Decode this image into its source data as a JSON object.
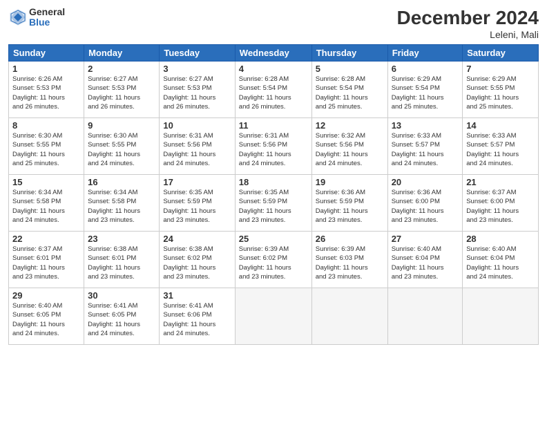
{
  "logo": {
    "general": "General",
    "blue": "Blue"
  },
  "header": {
    "title": "December 2024",
    "location": "Leleni, Mali"
  },
  "weekdays": [
    "Sunday",
    "Monday",
    "Tuesday",
    "Wednesday",
    "Thursday",
    "Friday",
    "Saturday"
  ],
  "weeks": [
    [
      {
        "day": "1",
        "info": "Sunrise: 6:26 AM\nSunset: 5:53 PM\nDaylight: 11 hours\nand 26 minutes."
      },
      {
        "day": "2",
        "info": "Sunrise: 6:27 AM\nSunset: 5:53 PM\nDaylight: 11 hours\nand 26 minutes."
      },
      {
        "day": "3",
        "info": "Sunrise: 6:27 AM\nSunset: 5:53 PM\nDaylight: 11 hours\nand 26 minutes."
      },
      {
        "day": "4",
        "info": "Sunrise: 6:28 AM\nSunset: 5:54 PM\nDaylight: 11 hours\nand 26 minutes."
      },
      {
        "day": "5",
        "info": "Sunrise: 6:28 AM\nSunset: 5:54 PM\nDaylight: 11 hours\nand 25 minutes."
      },
      {
        "day": "6",
        "info": "Sunrise: 6:29 AM\nSunset: 5:54 PM\nDaylight: 11 hours\nand 25 minutes."
      },
      {
        "day": "7",
        "info": "Sunrise: 6:29 AM\nSunset: 5:55 PM\nDaylight: 11 hours\nand 25 minutes."
      }
    ],
    [
      {
        "day": "8",
        "info": "Sunrise: 6:30 AM\nSunset: 5:55 PM\nDaylight: 11 hours\nand 25 minutes."
      },
      {
        "day": "9",
        "info": "Sunrise: 6:30 AM\nSunset: 5:55 PM\nDaylight: 11 hours\nand 24 minutes."
      },
      {
        "day": "10",
        "info": "Sunrise: 6:31 AM\nSunset: 5:56 PM\nDaylight: 11 hours\nand 24 minutes."
      },
      {
        "day": "11",
        "info": "Sunrise: 6:31 AM\nSunset: 5:56 PM\nDaylight: 11 hours\nand 24 minutes."
      },
      {
        "day": "12",
        "info": "Sunrise: 6:32 AM\nSunset: 5:56 PM\nDaylight: 11 hours\nand 24 minutes."
      },
      {
        "day": "13",
        "info": "Sunrise: 6:33 AM\nSunset: 5:57 PM\nDaylight: 11 hours\nand 24 minutes."
      },
      {
        "day": "14",
        "info": "Sunrise: 6:33 AM\nSunset: 5:57 PM\nDaylight: 11 hours\nand 24 minutes."
      }
    ],
    [
      {
        "day": "15",
        "info": "Sunrise: 6:34 AM\nSunset: 5:58 PM\nDaylight: 11 hours\nand 24 minutes."
      },
      {
        "day": "16",
        "info": "Sunrise: 6:34 AM\nSunset: 5:58 PM\nDaylight: 11 hours\nand 23 minutes."
      },
      {
        "day": "17",
        "info": "Sunrise: 6:35 AM\nSunset: 5:59 PM\nDaylight: 11 hours\nand 23 minutes."
      },
      {
        "day": "18",
        "info": "Sunrise: 6:35 AM\nSunset: 5:59 PM\nDaylight: 11 hours\nand 23 minutes."
      },
      {
        "day": "19",
        "info": "Sunrise: 6:36 AM\nSunset: 5:59 PM\nDaylight: 11 hours\nand 23 minutes."
      },
      {
        "day": "20",
        "info": "Sunrise: 6:36 AM\nSunset: 6:00 PM\nDaylight: 11 hours\nand 23 minutes."
      },
      {
        "day": "21",
        "info": "Sunrise: 6:37 AM\nSunset: 6:00 PM\nDaylight: 11 hours\nand 23 minutes."
      }
    ],
    [
      {
        "day": "22",
        "info": "Sunrise: 6:37 AM\nSunset: 6:01 PM\nDaylight: 11 hours\nand 23 minutes."
      },
      {
        "day": "23",
        "info": "Sunrise: 6:38 AM\nSunset: 6:01 PM\nDaylight: 11 hours\nand 23 minutes."
      },
      {
        "day": "24",
        "info": "Sunrise: 6:38 AM\nSunset: 6:02 PM\nDaylight: 11 hours\nand 23 minutes."
      },
      {
        "day": "25",
        "info": "Sunrise: 6:39 AM\nSunset: 6:02 PM\nDaylight: 11 hours\nand 23 minutes."
      },
      {
        "day": "26",
        "info": "Sunrise: 6:39 AM\nSunset: 6:03 PM\nDaylight: 11 hours\nand 23 minutes."
      },
      {
        "day": "27",
        "info": "Sunrise: 6:40 AM\nSunset: 6:04 PM\nDaylight: 11 hours\nand 23 minutes."
      },
      {
        "day": "28",
        "info": "Sunrise: 6:40 AM\nSunset: 6:04 PM\nDaylight: 11 hours\nand 24 minutes."
      }
    ],
    [
      {
        "day": "29",
        "info": "Sunrise: 6:40 AM\nSunset: 6:05 PM\nDaylight: 11 hours\nand 24 minutes."
      },
      {
        "day": "30",
        "info": "Sunrise: 6:41 AM\nSunset: 6:05 PM\nDaylight: 11 hours\nand 24 minutes."
      },
      {
        "day": "31",
        "info": "Sunrise: 6:41 AM\nSunset: 6:06 PM\nDaylight: 11 hours\nand 24 minutes."
      },
      {
        "day": "",
        "info": ""
      },
      {
        "day": "",
        "info": ""
      },
      {
        "day": "",
        "info": ""
      },
      {
        "day": "",
        "info": ""
      }
    ]
  ]
}
